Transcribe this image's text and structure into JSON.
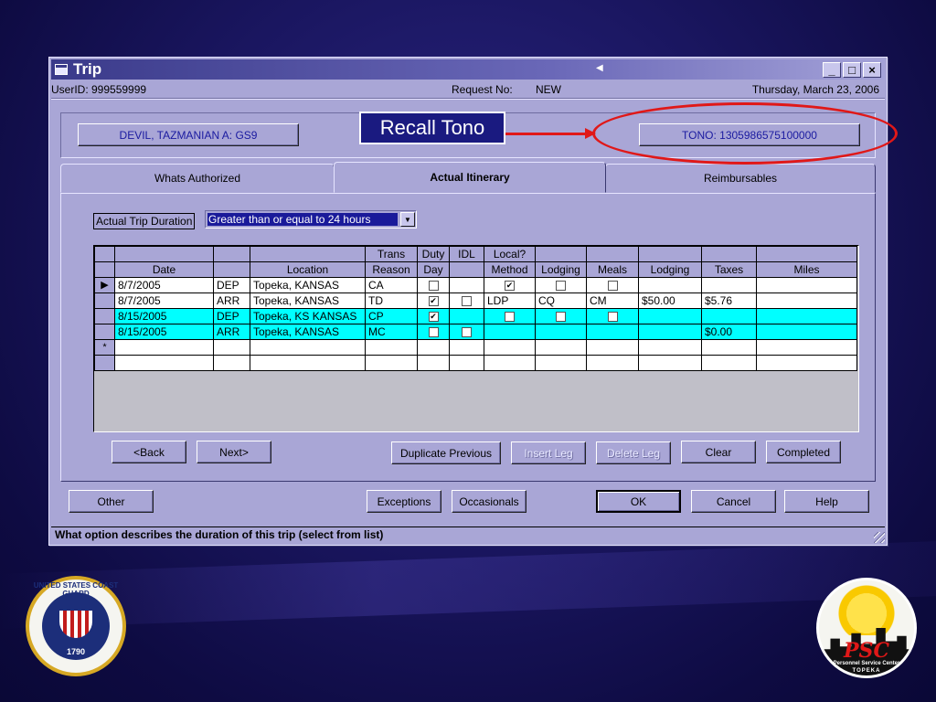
{
  "window": {
    "title": "Trip",
    "user_id": "UserID: 999559999",
    "request_no_label": "Request No:",
    "request_no_value": "NEW",
    "date": "Thursday, March 23, 2006",
    "min_label": "_",
    "max_label": "□",
    "close_label": "×"
  },
  "top": {
    "member_button": "DEVIL, TAZMANIAN A: GS9",
    "tono_button": "TONO: 1305986575100000",
    "callout_text": "Recall Tono"
  },
  "tabs": [
    {
      "label": "Whats Authorized",
      "active": false
    },
    {
      "label": "Actual Itinerary",
      "active": true
    },
    {
      "label": "Reimbursables",
      "active": false
    }
  ],
  "duration": {
    "label": "Actual Trip Duration",
    "selected": "Greater than or equal to 24 hours",
    "arrow": "▼"
  },
  "grid": {
    "header_top": [
      "",
      "",
      "",
      "",
      "Trans",
      "Duty",
      "IDL",
      "Local?",
      "",
      "",
      "",
      "",
      ""
    ],
    "header_bottom": [
      "",
      "Date",
      "",
      "Location",
      "Reason",
      "Day",
      "",
      "Method",
      "Lodging",
      "Meals",
      "Lodging",
      "Taxes",
      "Miles"
    ],
    "rows": [
      {
        "selector": "▶",
        "style": "white",
        "date": "8/7/2005",
        "type": "DEP",
        "location": "Topeka,  KANSAS",
        "reason": "CA",
        "duty": "unchecked",
        "idl": "none",
        "method": "checked",
        "lodging_chk": "unchecked",
        "meals": "unchecked",
        "lodging_amt": "",
        "taxes": "",
        "miles": ""
      },
      {
        "selector": "",
        "style": "white",
        "date": "8/7/2005",
        "type": "ARR",
        "location": "Topeka,  KANSAS",
        "reason": "TD",
        "duty": "checked",
        "idl": "unchecked",
        "method": "LDP",
        "lodging_chk": "CQ",
        "meals": "CM",
        "lodging_amt": "$50.00",
        "taxes": "$5.76",
        "miles": ""
      },
      {
        "selector": "",
        "style": "cyan",
        "date": "8/15/2005",
        "type": "DEP",
        "location": "Topeka, KS KANSAS",
        "reason": "CP",
        "duty": "checked",
        "idl": "none",
        "method": "unchecked",
        "lodging_chk": "unchecked",
        "meals": "unchecked",
        "lodging_amt": "",
        "taxes": "",
        "miles": ""
      },
      {
        "selector": "",
        "style": "cyan",
        "date": "8/15/2005",
        "type": "ARR",
        "location": "Topeka,  KANSAS",
        "reason": "MC",
        "duty": "unchecked",
        "idl": "unchecked",
        "method": "",
        "lodging_chk": "",
        "meals": "",
        "lodging_amt": "",
        "taxes": "$0.00",
        "miles": ""
      },
      {
        "selector": "*",
        "style": "white",
        "date": "",
        "type": "",
        "location": "",
        "reason": "",
        "duty": "none",
        "idl": "none",
        "method": "",
        "lodging_chk": "",
        "meals": "",
        "lodging_amt": "",
        "taxes": "",
        "miles": ""
      }
    ]
  },
  "nav_buttons": {
    "back": "<Back",
    "next": "Next>",
    "duplicate": "Duplicate Previous",
    "insert": "Insert Leg",
    "delete": "Delete Leg",
    "clear": "Clear",
    "completed": "Completed"
  },
  "bottom_buttons": {
    "other": "Other",
    "exceptions": "Exceptions",
    "occasionals": "Occasionals",
    "ok": "OK",
    "cancel": "Cancel",
    "help": "Help"
  },
  "status": "What option describes the duration of this trip (select from list)",
  "logos": {
    "uscg_text": "UNITED STATES COAST GUARD",
    "uscg_year": "1790",
    "psc_text": "PSC",
    "psc_sub": "Personnel Service Center",
    "psc_city": "TOPEKA"
  }
}
